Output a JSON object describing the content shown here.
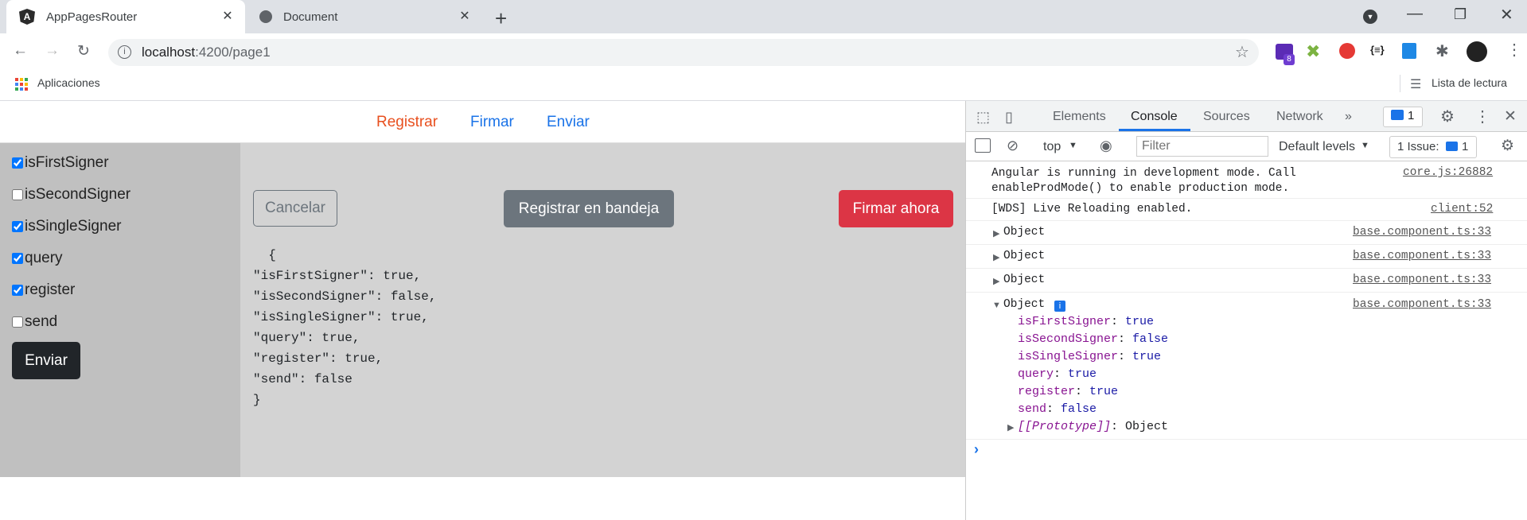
{
  "browser": {
    "tabs": [
      {
        "title": "AppPagesRouter",
        "active": true
      },
      {
        "title": "Document",
        "active": false
      }
    ],
    "url_host": "localhost",
    "url_rest": ":4200/page1",
    "bookmarks": {
      "apps_label": "Aplicaciones",
      "reading_list_label": "Lista de lectura"
    },
    "extension_badge": "8"
  },
  "page": {
    "nav": {
      "registrar": "Registrar",
      "firmar": "Firmar",
      "enviar": "Enviar"
    },
    "checkboxes": [
      {
        "label": "isFirstSigner",
        "checked": true
      },
      {
        "label": "isSecondSigner",
        "checked": false
      },
      {
        "label": "isSingleSigner",
        "checked": true
      },
      {
        "label": "query",
        "checked": true
      },
      {
        "label": "register",
        "checked": true
      },
      {
        "label": "send",
        "checked": false
      }
    ],
    "submit_label": "Enviar",
    "cancel_label": "Cancelar",
    "register_label": "Registrar en bandeja",
    "sign_label": "Firmar ahora",
    "json_text": "  {\n\"isFirstSigner\": true,\n\"isSecondSigner\": false,\n\"isSingleSigner\": true,\n\"query\": true,\n\"register\": true,\n\"send\": false\n}"
  },
  "devtools": {
    "tabs": [
      "Elements",
      "Console",
      "Sources",
      "Network"
    ],
    "active_tab": "Console",
    "issues_badge": "1",
    "context": "top",
    "filter_placeholder": "Filter",
    "levels": "Default levels",
    "issues_label": "1 Issue:",
    "issues_count": "1",
    "logs": [
      {
        "text": "Angular is running in development mode. Call\nenableProdMode() to enable production mode.",
        "source": "core.js:26882"
      },
      {
        "text": "[WDS] Live Reloading enabled.",
        "source": "client:52"
      },
      {
        "text": "Object",
        "source": "base.component.ts:33"
      },
      {
        "text": "Object",
        "source": "base.component.ts:33"
      },
      {
        "text": "Object",
        "source": "base.component.ts:33"
      },
      {
        "text": "Object",
        "source": "base.component.ts:33"
      }
    ],
    "object_props": [
      {
        "key": "isFirstSigner",
        "value": "true"
      },
      {
        "key": "isSecondSigner",
        "value": "false"
      },
      {
        "key": "isSingleSigner",
        "value": "true"
      },
      {
        "key": "query",
        "value": "true"
      },
      {
        "key": "register",
        "value": "true"
      },
      {
        "key": "send",
        "value": "false"
      }
    ],
    "prototype_key": "[[Prototype]]",
    "prototype_value": "Object",
    "prompt": "›"
  }
}
